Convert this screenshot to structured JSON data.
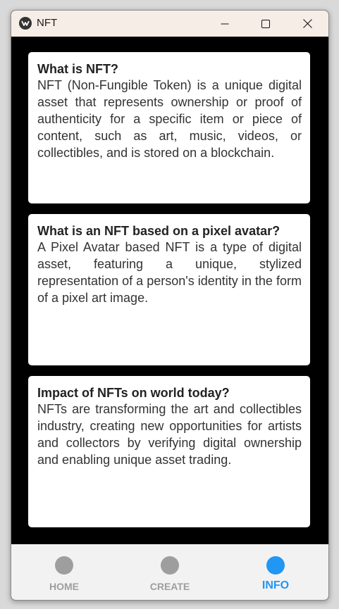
{
  "window": {
    "title": "NFT",
    "icon": "app-logo-icon",
    "controls": [
      "minimize-icon",
      "maximize-icon",
      "close-icon"
    ]
  },
  "cards": [
    {
      "title": "What is NFT?",
      "body": "NFT (Non-Fungible Token) is a unique digital asset that represents ownership or proof of authenticity for a specific item or piece of content, such as art, music, videos, or collectibles, and is stored on a blockchain."
    },
    {
      "title": "What is an NFT based on a pixel avatar?",
      "body": "A Pixel Avatar based NFT is a type of digital asset, featuring a unique, stylized representation of a person's identity in the form of a pixel art image."
    },
    {
      "title": "Impact of NFTs on world today?",
      "body": "NFTs are transforming the art and collectibles industry, creating new opportunities for artists and collectors by verifying digital ownership and enabling unique asset trading."
    }
  ],
  "nav": {
    "items": [
      {
        "label": "HOME",
        "active": false
      },
      {
        "label": "CREATE",
        "active": false
      },
      {
        "label": "INFO",
        "active": true
      }
    ],
    "active_color": "#2196f3",
    "inactive_color": "#9e9e9e"
  },
  "colors": {
    "background": "#000000",
    "titlebar": "#f6eee6",
    "card": "#ffffff",
    "navbar": "#f2f2f2"
  }
}
